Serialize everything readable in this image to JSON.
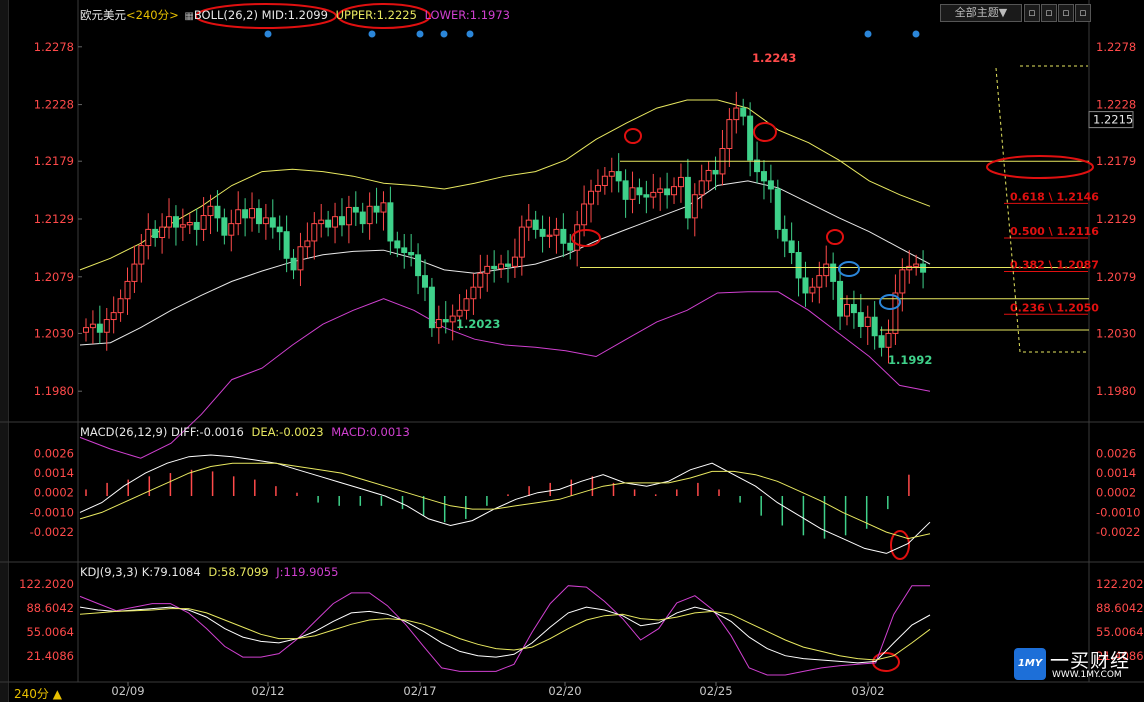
{
  "window": {
    "symbol": "欧元美元",
    "period": "<240分>",
    "period_badge": "240分 ▲",
    "theme_button": "全部主题▼"
  },
  "boll": {
    "label": "BOLL(26,2)",
    "mid": "MID:1.2099",
    "upper": "UPPER:1.2225",
    "lower": "LOWER:1.1973"
  },
  "macd": {
    "label": "MACD(26,12,9)",
    "diff": "DIFF:-0.0016",
    "dea": "DEA:-0.0023",
    "macd": "MACD:0.0013"
  },
  "kdj": {
    "label": "KDJ(9,3,3)",
    "k": "K:79.1084",
    "d": "D:58.7099",
    "j": "J:119.9055"
  },
  "logo": {
    "box": "1MY",
    "name": "一买财经",
    "url": "WWW.1MY.COM"
  },
  "colors": {
    "up": "#ff4a4a",
    "down": "#3fd18a",
    "boll_upper": "#e8e860",
    "boll_mid": "#e8e8e8",
    "boll_lower": "#d040d0",
    "macd_dea": "#e8e860",
    "macd_diff": "#ffffff",
    "kdj_k": "#ffffff",
    "kdj_d": "#e8e860",
    "kdj_j": "#d040d0",
    "annotation": "#e01010",
    "blue_marker": "#2b86d9"
  },
  "chart_data": [
    {
      "type": "candlestick",
      "title": "欧元美元 240分",
      "x_ticks": [
        "02/09",
        "02/12",
        "02/17",
        "02/20",
        "02/25",
        "03/02"
      ],
      "y_ticks": [
        "1.2278",
        "1.2228",
        "1.2179",
        "1.2129",
        "1.2079",
        "1.2030",
        "1.1980"
      ],
      "ylim": [
        1.1962,
        1.2296
      ],
      "current_price": "1.2215",
      "annotations": [
        "1.2243",
        "1.2023",
        "1.1992"
      ],
      "fib_levels": [
        {
          "label": "0.618 \\ 1.2146",
          "value": 1.2146
        },
        {
          "label": "0.500 \\ 1.2116",
          "value": 1.2116
        },
        {
          "label": "0.382 \\ 1.2087",
          "value": 1.2087
        },
        {
          "label": "0.236 \\ 1.2050",
          "value": 1.205
        }
      ],
      "horizontal_lines": [
        1.2179,
        1.2087,
        1.206,
        1.2033
      ],
      "closes": [
        1.2035,
        1.2038,
        1.2031,
        1.2042,
        1.2048,
        1.206,
        1.2075,
        1.209,
        1.2106,
        1.212,
        1.2113,
        1.2122,
        1.2131,
        1.2122,
        1.2124,
        1.2126,
        1.212,
        1.2132,
        1.214,
        1.213,
        1.2115,
        1.2125,
        1.2137,
        1.213,
        1.2138,
        1.2125,
        1.213,
        1.2122,
        1.2118,
        1.2095,
        1.2085,
        1.2105,
        1.211,
        1.2125,
        1.2128,
        1.2122,
        1.2131,
        1.2124,
        1.2139,
        1.2135,
        1.2125,
        1.214,
        1.2135,
        1.2143,
        1.211,
        1.2104,
        1.21,
        1.2098,
        1.208,
        1.207,
        1.2035,
        1.2042,
        1.204,
        1.2045,
        1.205,
        1.206,
        1.207,
        1.2082,
        1.2088,
        1.2086,
        1.209,
        1.2088,
        1.2096,
        1.2122,
        1.2128,
        1.212,
        1.2114,
        1.2115,
        1.212,
        1.2108,
        1.2102,
        1.2124,
        1.2142,
        1.2153,
        1.2158,
        1.2166,
        1.217,
        1.2162,
        1.2146,
        1.2156,
        1.215,
        1.2148,
        1.2152,
        1.2155,
        1.215,
        1.2157,
        1.2165,
        1.213,
        1.215,
        1.2162,
        1.2171,
        1.2168,
        1.219,
        1.2215,
        1.2225,
        1.2218,
        1.218,
        1.217,
        1.2162,
        1.2155,
        1.212,
        1.211,
        1.21,
        1.2078,
        1.2065,
        1.207,
        1.208,
        1.209,
        1.2075,
        1.2045,
        1.2055,
        1.2048,
        1.2036,
        1.2044,
        1.2028,
        1.2018,
        1.203,
        1.2065,
        1.2085,
        1.2088,
        1.209,
        1.2083
      ],
      "boll_upper": [
        1.2085,
        1.2095,
        1.2108,
        1.2125,
        1.214,
        1.2158,
        1.217,
        1.2172,
        1.217,
        1.2166,
        1.216,
        1.2158,
        1.2155,
        1.216,
        1.2166,
        1.217,
        1.218,
        1.2198,
        1.2212,
        1.2225,
        1.2232,
        1.2232,
        1.2225,
        1.2206,
        1.2195,
        1.218,
        1.2162,
        1.215,
        1.214
      ],
      "boll_mid": [
        1.202,
        1.2022,
        1.2035,
        1.205,
        1.2063,
        1.2075,
        1.2084,
        1.2092,
        1.2098,
        1.2101,
        1.2102,
        1.2095,
        1.2085,
        1.2082,
        1.2086,
        1.209,
        1.2098,
        1.211,
        1.212,
        1.213,
        1.214,
        1.2158,
        1.2162,
        1.2156,
        1.2143,
        1.213,
        1.2118,
        1.2104,
        1.209
      ],
      "boll_lower": [
        1.194,
        1.193,
        1.1922,
        1.1935,
        1.196,
        1.199,
        1.2,
        1.202,
        1.2038,
        1.205,
        1.206,
        1.205,
        1.2035,
        1.2025,
        1.202,
        1.2018,
        1.2015,
        1.201,
        1.2025,
        1.204,
        1.205,
        1.2065,
        1.2066,
        1.2066,
        1.205,
        1.203,
        1.201,
        1.1985,
        1.198
      ]
    },
    {
      "type": "bar",
      "title": "MACD(26,12,9)",
      "y_ticks": [
        "0.0026",
        "0.0014",
        "0.0002",
        "-0.0010",
        "-0.0022"
      ],
      "ylim": [
        -0.0036,
        0.0036
      ],
      "series": [
        {
          "name": "DIFF",
          "values": [
            -0.001,
            -0.0004,
            0.0006,
            0.0014,
            0.002,
            0.0024,
            0.0025,
            0.0024,
            0.0022,
            0.002,
            0.0016,
            0.0012,
            0.0008,
            0.0004,
            0.0,
            -0.0006,
            -0.0014,
            -0.0018,
            -0.0015,
            -0.0008,
            -0.0002,
            0.0002,
            0.0004,
            0.0009,
            0.0013,
            0.0008,
            0.0006,
            0.0009,
            0.0016,
            0.002,
            0.0013,
            0.0006,
            -0.0004,
            -0.0012,
            -0.002,
            -0.0026,
            -0.0032,
            -0.0035,
            -0.0029,
            -0.0016
          ]
        },
        {
          "name": "DEA",
          "values": [
            -0.0014,
            -0.001,
            -0.0004,
            0.0002,
            0.0008,
            0.0014,
            0.0018,
            0.002,
            0.002,
            0.002,
            0.0018,
            0.0016,
            0.0014,
            0.001,
            0.0006,
            0.0002,
            -0.0002,
            -0.0006,
            -0.0008,
            -0.0008,
            -0.0006,
            -0.0004,
            -0.0002,
            0.0002,
            0.0006,
            0.0008,
            0.0008,
            0.0008,
            0.0011,
            0.0015,
            0.0015,
            0.0013,
            0.0009,
            0.0003,
            -0.0003,
            -0.001,
            -0.0016,
            -0.0022,
            -0.0026,
            -0.0023
          ]
        },
        {
          "name": "MACD",
          "values": [
            0.0004,
            0.0008,
            0.001,
            0.0012,
            0.0014,
            0.0016,
            0.0015,
            0.0012,
            0.001,
            0.0006,
            0.0002,
            -0.0004,
            -0.0006,
            -0.0006,
            -0.0006,
            -0.0008,
            -0.0012,
            -0.0016,
            -0.0014,
            -0.0006,
            0.0001,
            0.0006,
            0.0008,
            0.001,
            0.0012,
            0.0008,
            0.0004,
            0.0001,
            0.0004,
            0.0008,
            0.0004,
            -0.0004,
            -0.0012,
            -0.0018,
            -0.0024,
            -0.0026,
            -0.0024,
            -0.002,
            -0.0008,
            0.0013
          ]
        }
      ]
    },
    {
      "type": "line",
      "title": "KDJ(9,3,3)",
      "y_ticks": [
        "122.2020",
        "88.6042",
        "55.0064",
        "21.4086"
      ],
      "ylim": [
        -12,
        135
      ],
      "series": [
        {
          "name": "K",
          "values": [
            90,
            86,
            84,
            86,
            88,
            90,
            86,
            76,
            60,
            48,
            42,
            40,
            46,
            56,
            70,
            82,
            84,
            80,
            70,
            56,
            40,
            28,
            22,
            20,
            24,
            40,
            62,
            82,
            90,
            86,
            78,
            64,
            68,
            82,
            90,
            84,
            70,
            48,
            32,
            22,
            18,
            16,
            14,
            12,
            14,
            40,
            65,
            79
          ]
        },
        {
          "name": "D",
          "values": [
            80,
            82,
            84,
            85,
            86,
            88,
            88,
            82,
            72,
            62,
            52,
            46,
            46,
            50,
            58,
            66,
            72,
            74,
            72,
            66,
            56,
            46,
            38,
            32,
            30,
            34,
            46,
            60,
            72,
            78,
            80,
            74,
            72,
            76,
            82,
            84,
            80,
            68,
            56,
            44,
            34,
            28,
            22,
            18,
            16,
            22,
            40,
            59
          ]
        },
        {
          "name": "J",
          "values": [
            105,
            95,
            85,
            90,
            95,
            95,
            82,
            60,
            35,
            20,
            20,
            25,
            45,
            70,
            95,
            110,
            110,
            92,
            66,
            35,
            5,
            0,
            0,
            0,
            10,
            55,
            95,
            120,
            118,
            98,
            74,
            44,
            60,
            96,
            106,
            86,
            50,
            5,
            -5,
            -5,
            0,
            5,
            8,
            10,
            12,
            80,
            120,
            120
          ]
        }
      ]
    }
  ]
}
